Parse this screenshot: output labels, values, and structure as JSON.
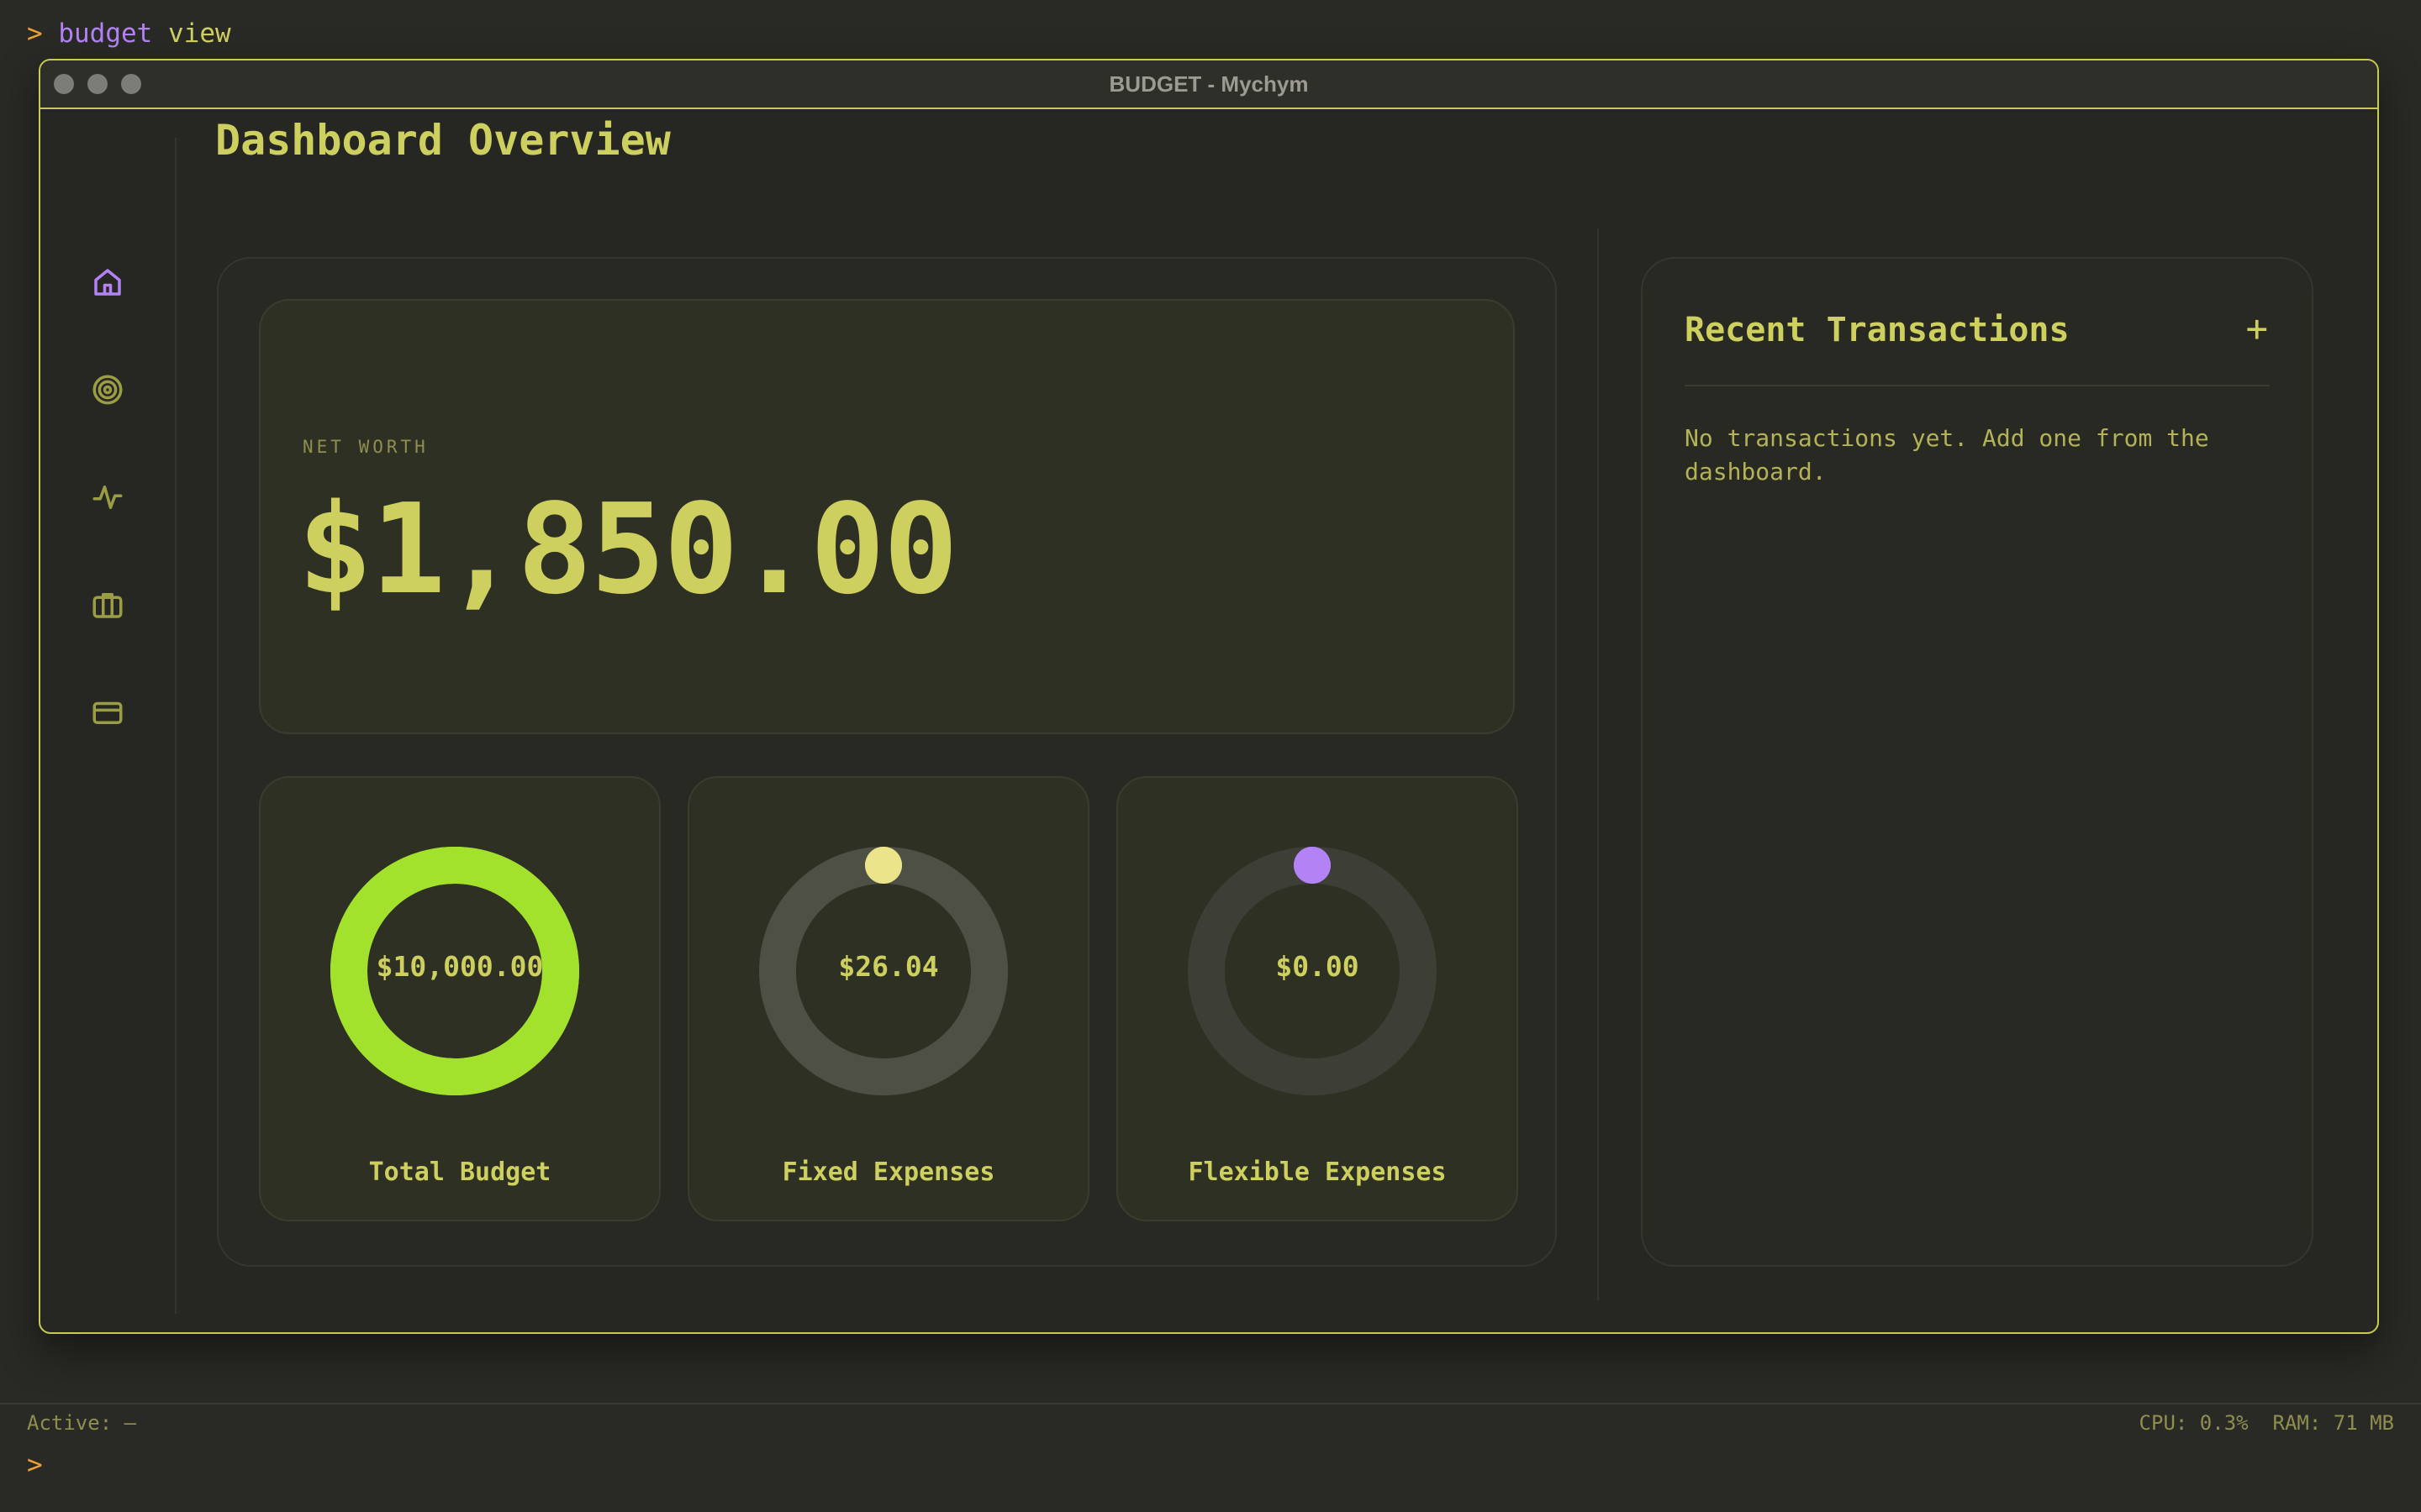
{
  "terminal": {
    "prompt": ">",
    "command": "budget",
    "argument": "view"
  },
  "window": {
    "title": "BUDGET - Mychym"
  },
  "sidebar": {
    "items": [
      {
        "icon": "home-icon",
        "active": true
      },
      {
        "icon": "target-icon",
        "active": false
      },
      {
        "icon": "activity-icon",
        "active": false
      },
      {
        "icon": "briefcase-icon",
        "active": false
      },
      {
        "icon": "credit-card-icon",
        "active": false
      }
    ]
  },
  "dashboard": {
    "title": "Dashboard Overview",
    "net_worth": {
      "label": "NET WORTH",
      "value": "$1,850.00"
    },
    "stats": [
      {
        "label": "Total Budget",
        "value": "$10,000.00",
        "progress": 1.0,
        "color": "#a2e22c",
        "track": "#a2e22c"
      },
      {
        "label": "Fixed Expenses",
        "value": "$26.04",
        "progress": 0.0,
        "color": "#ece48a",
        "track": "#4e4f45"
      },
      {
        "label": "Flexible Expenses",
        "value": "$0.00",
        "progress": 0.0,
        "color": "#b383f5",
        "track": "#3d3e36"
      }
    ]
  },
  "transactions": {
    "title": "Recent Transactions",
    "add_label": "+",
    "empty_message": "No transactions yet. Add one from the dashboard."
  },
  "status": {
    "active": "Active: —",
    "cpu": "CPU: 0.3%",
    "ram": "RAM: 71 MB",
    "prompt": ">"
  },
  "colors": {
    "accent": "#cdd05e",
    "active_icon": "#b383f5",
    "prompt": "#f0a030"
  }
}
